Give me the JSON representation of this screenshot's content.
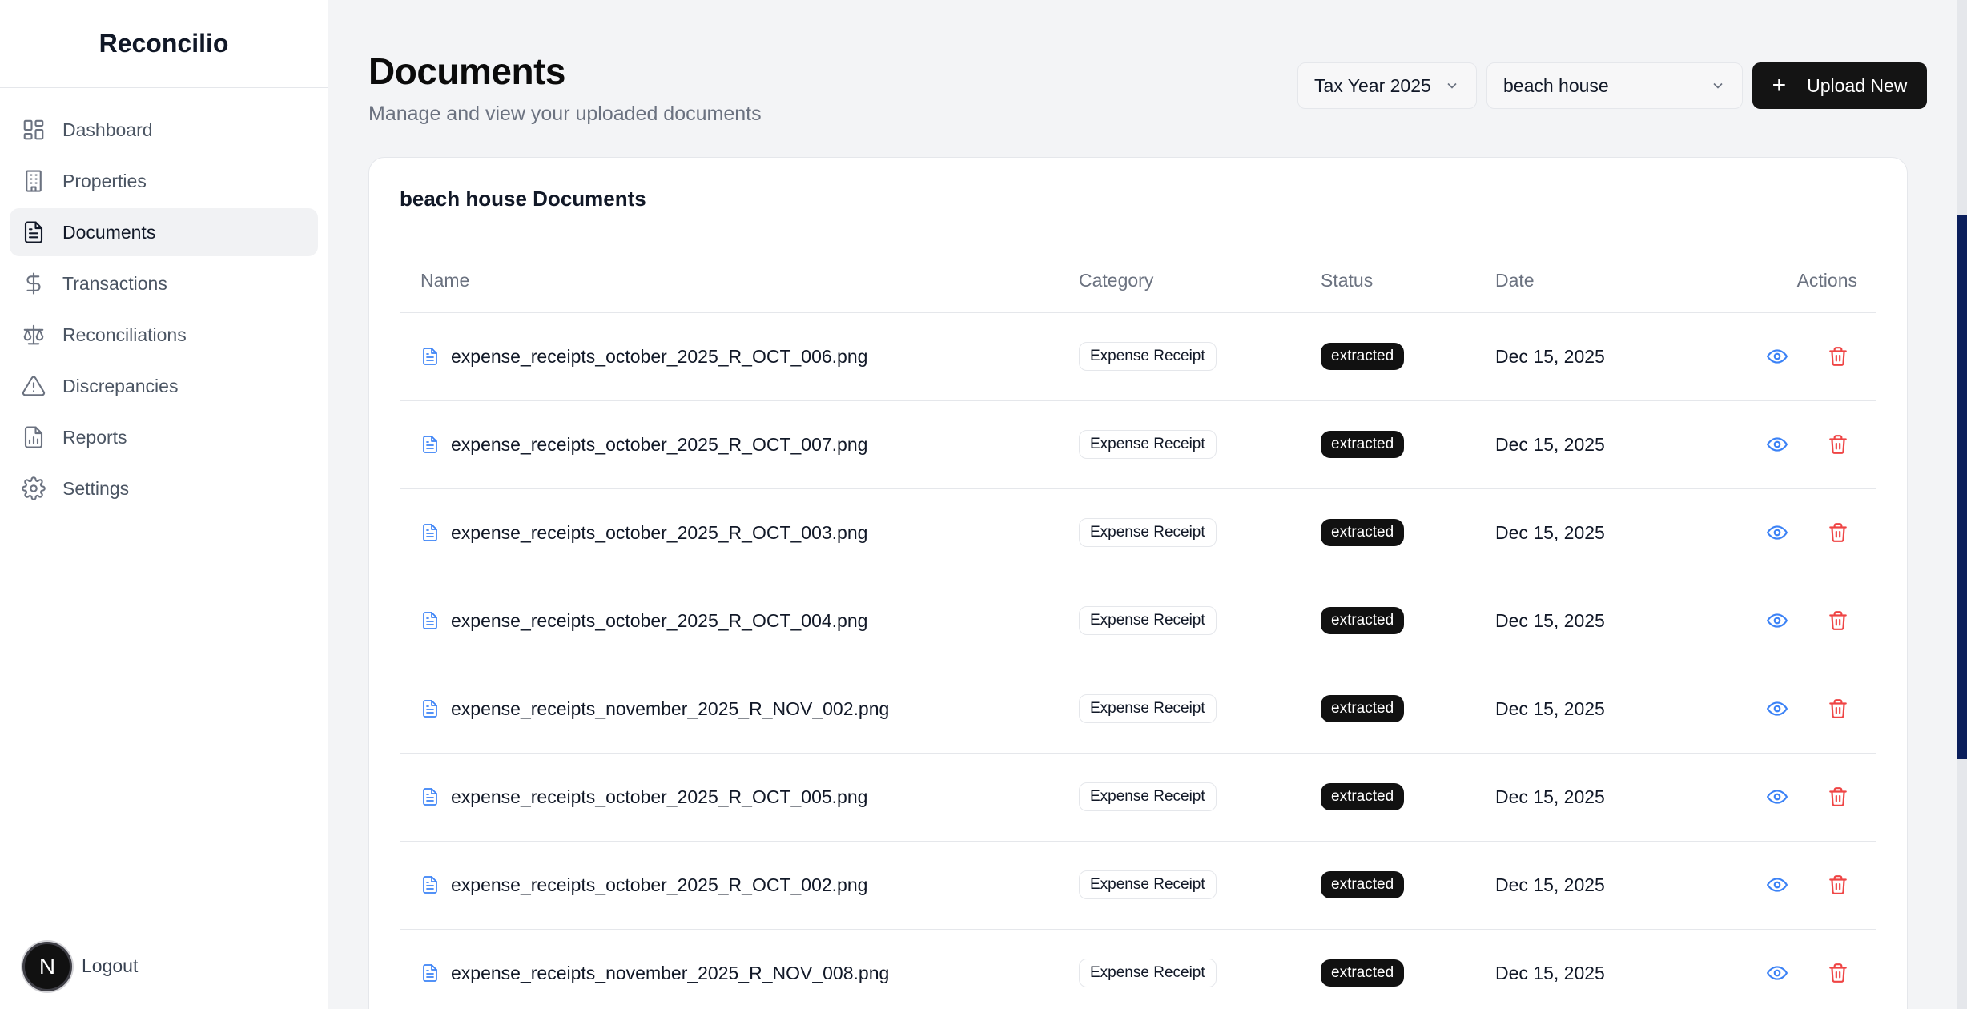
{
  "app": {
    "brand": "Reconcilio"
  },
  "sidebar": {
    "items": [
      {
        "label": "Dashboard",
        "icon": "dashboard-icon",
        "active": false
      },
      {
        "label": "Properties",
        "icon": "building-icon",
        "active": false
      },
      {
        "label": "Documents",
        "icon": "document-icon",
        "active": true
      },
      {
        "label": "Transactions",
        "icon": "dollar-icon",
        "active": false
      },
      {
        "label": "Reconciliations",
        "icon": "scale-icon",
        "active": false
      },
      {
        "label": "Discrepancies",
        "icon": "warning-icon",
        "active": false
      },
      {
        "label": "Reports",
        "icon": "report-icon",
        "active": false
      },
      {
        "label": "Settings",
        "icon": "gear-icon",
        "active": false
      }
    ],
    "avatar_initial": "N",
    "logout_label": "Logout"
  },
  "header": {
    "title": "Documents",
    "subtitle": "Manage and view your uploaded documents",
    "year_select": "Tax Year 2025",
    "property_select": "beach house",
    "upload_label": "Upload New"
  },
  "card": {
    "title": "beach house Documents",
    "columns": {
      "name": "Name",
      "category": "Category",
      "status": "Status",
      "date": "Date",
      "actions": "Actions"
    },
    "rows": [
      {
        "name": "expense_receipts_october_2025_R_OCT_006.png",
        "category": "Expense Receipt",
        "status": "extracted",
        "date": "Dec 15, 2025"
      },
      {
        "name": "expense_receipts_october_2025_R_OCT_007.png",
        "category": "Expense Receipt",
        "status": "extracted",
        "date": "Dec 15, 2025"
      },
      {
        "name": "expense_receipts_october_2025_R_OCT_003.png",
        "category": "Expense Receipt",
        "status": "extracted",
        "date": "Dec 15, 2025"
      },
      {
        "name": "expense_receipts_october_2025_R_OCT_004.png",
        "category": "Expense Receipt",
        "status": "extracted",
        "date": "Dec 15, 2025"
      },
      {
        "name": "expense_receipts_november_2025_R_NOV_002.png",
        "category": "Expense Receipt",
        "status": "extracted",
        "date": "Dec 15, 2025"
      },
      {
        "name": "expense_receipts_october_2025_R_OCT_005.png",
        "category": "Expense Receipt",
        "status": "extracted",
        "date": "Dec 15, 2025"
      },
      {
        "name": "expense_receipts_october_2025_R_OCT_002.png",
        "category": "Expense Receipt",
        "status": "extracted",
        "date": "Dec 15, 2025"
      },
      {
        "name": "expense_receipts_november_2025_R_NOV_008.png",
        "category": "Expense Receipt",
        "status": "extracted",
        "date": "Dec 15, 2025"
      }
    ]
  },
  "colors": {
    "accent_blue": "#3b82f6",
    "danger_red": "#ef4444",
    "primary_dark": "#141414"
  }
}
